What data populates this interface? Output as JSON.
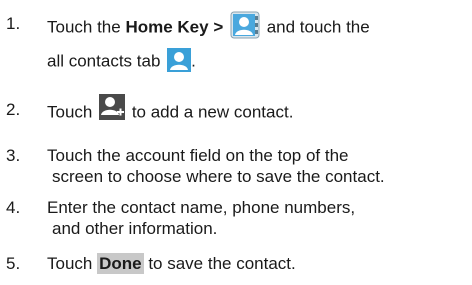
{
  "steps": [
    {
      "number": "1.",
      "line1": {
        "before": "Touch the ",
        "bold": "Home Key > ",
        "after": " and touch the"
      },
      "line2": "all contacts tab",
      "line2_end": "."
    },
    {
      "number": "2.",
      "before": "Touch ",
      "after": " to add a new contact."
    },
    {
      "number": "3.",
      "line1": "Touch the account field on the top of the",
      "line2": "screen to choose where to save the contact."
    },
    {
      "number": "4.",
      "line1": "Enter the contact name, phone numbers,",
      "line2": "and other information."
    },
    {
      "number": "5.",
      "before": "Touch ",
      "done": "Done",
      "after": " to save the contact."
    }
  ],
  "icons": {
    "people_app": "contacts-app-icon",
    "all_contacts_tab": "all-contacts-tab-icon",
    "add_contact": "add-contact-icon"
  },
  "colors": {
    "icon_blue": "#3aa0d8",
    "done_highlight": "#c8c8c8"
  }
}
